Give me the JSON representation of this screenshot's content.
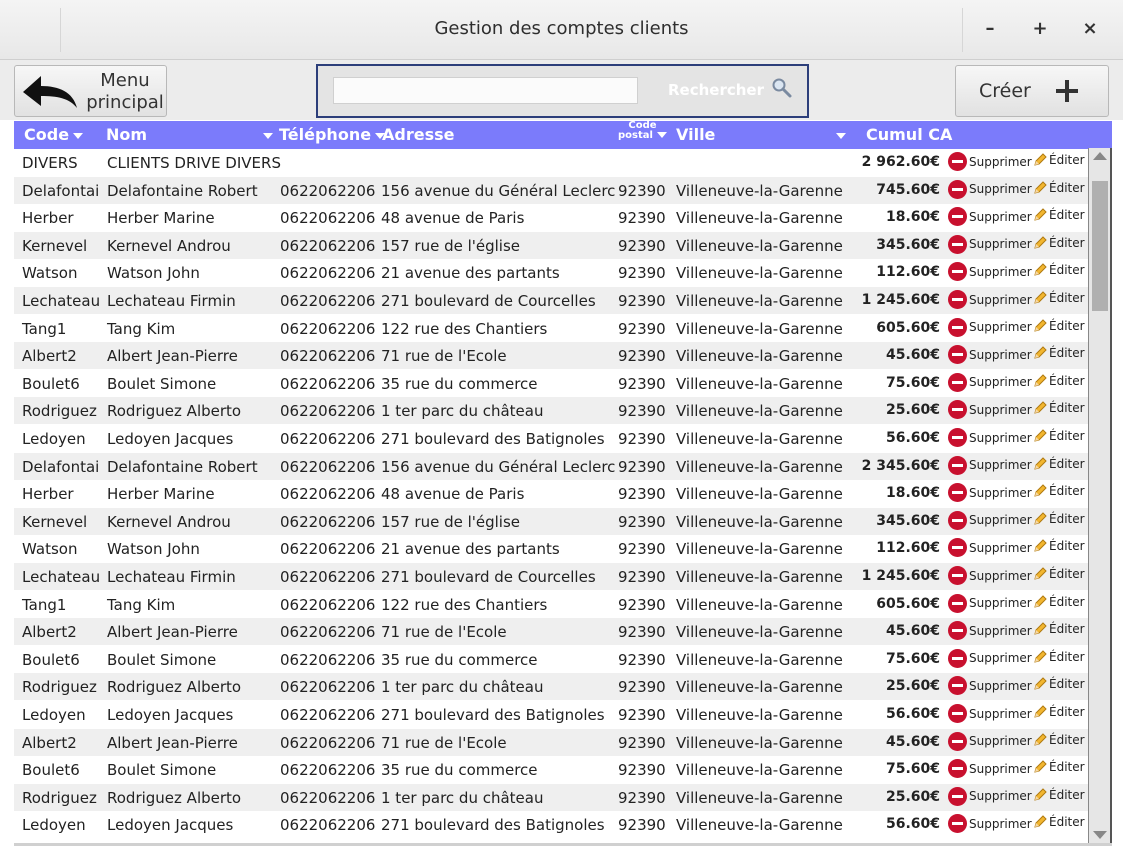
{
  "window": {
    "title": "Gestion des comptes clients",
    "minimize_label": "–",
    "maximize_label": "+",
    "close_label": "×"
  },
  "toolbar": {
    "menu_label_line1": "Menu",
    "menu_label_line2": "principal",
    "search_placeholder": "",
    "search_label": "Rechercher",
    "create_label": "Créer"
  },
  "columns": {
    "code": "Code",
    "nom": "Nom",
    "telephone": "Téléphone",
    "adresse": "Adresse",
    "cp_line1": "Code",
    "cp_line2": "postal",
    "ville": "Ville",
    "ca": "Cumul CA"
  },
  "actions": {
    "delete_label": "Supprimer",
    "edit_label": "Éditer"
  },
  "rows": [
    {
      "code": "DIVERS",
      "nom": "CLIENTS DRIVE DIVERS",
      "tel": "",
      "adr": "",
      "cp": "",
      "ville": "",
      "ca": "2 962.60€"
    },
    {
      "code": "Delafontai",
      "nom": "Delafontaine Robert",
      "tel": "0622062206",
      "adr": "156 avenue du Général Leclerc",
      "cp": "92390",
      "ville": "Villeneuve-la-Garenne",
      "ca": "745.60€"
    },
    {
      "code": "Herber",
      "nom": "Herber Marine",
      "tel": "0622062206",
      "adr": "48 avenue de Paris",
      "cp": "92390",
      "ville": "Villeneuve-la-Garenne",
      "ca": "18.60€"
    },
    {
      "code": "Kernevel",
      "nom": "Kernevel Androu",
      "tel": "0622062206",
      "adr": "157 rue de l'église",
      "cp": "92390",
      "ville": "Villeneuve-la-Garenne",
      "ca": "345.60€"
    },
    {
      "code": "Watson",
      "nom": "Watson John",
      "tel": "0622062206",
      "adr": "21 avenue des partants",
      "cp": "92390",
      "ville": "Villeneuve-la-Garenne",
      "ca": "112.60€"
    },
    {
      "code": "Lechateau",
      "nom": "Lechateau Firmin",
      "tel": "0622062206",
      "adr": "271 boulevard de Courcelles",
      "cp": "92390",
      "ville": "Villeneuve-la-Garenne",
      "ca": "1 245.60€"
    },
    {
      "code": "Tang1",
      "nom": "Tang Kim",
      "tel": "0622062206",
      "adr": "122 rue des Chantiers",
      "cp": "92390",
      "ville": "Villeneuve-la-Garenne",
      "ca": "605.60€"
    },
    {
      "code": "Albert2",
      "nom": "Albert Jean-Pierre",
      "tel": "0622062206",
      "adr": "71 rue de l'Ecole",
      "cp": "92390",
      "ville": "Villeneuve-la-Garenne",
      "ca": "45.60€"
    },
    {
      "code": "Boulet6",
      "nom": "Boulet Simone",
      "tel": "0622062206",
      "adr": "35 rue du commerce",
      "cp": "92390",
      "ville": "Villeneuve-la-Garenne",
      "ca": "75.60€"
    },
    {
      "code": "Rodriguez",
      "nom": "Rodriguez Alberto",
      "tel": "0622062206",
      "adr": "1 ter parc du château",
      "cp": "92390",
      "ville": "Villeneuve-la-Garenne",
      "ca": "25.60€"
    },
    {
      "code": "Ledoyen",
      "nom": "Ledoyen Jacques",
      "tel": "0622062206",
      "adr": "271 boulevard des Batignoles",
      "cp": "92390",
      "ville": "Villeneuve-la-Garenne",
      "ca": "56.60€"
    },
    {
      "code": "Delafontai",
      "nom": "Delafontaine Robert",
      "tel": "0622062206",
      "adr": "156 avenue du Général Leclerc",
      "cp": "92390",
      "ville": "Villeneuve-la-Garenne",
      "ca": "2 345.60€"
    },
    {
      "code": "Herber",
      "nom": "Herber Marine",
      "tel": "0622062206",
      "adr": "48 avenue de Paris",
      "cp": "92390",
      "ville": "Villeneuve-la-Garenne",
      "ca": "18.60€"
    },
    {
      "code": "Kernevel",
      "nom": "Kernevel Androu",
      "tel": "0622062206",
      "adr": "157 rue de l'église",
      "cp": "92390",
      "ville": "Villeneuve-la-Garenne",
      "ca": "345.60€"
    },
    {
      "code": "Watson",
      "nom": "Watson John",
      "tel": "0622062206",
      "adr": "21 avenue des partants",
      "cp": "92390",
      "ville": "Villeneuve-la-Garenne",
      "ca": "112.60€"
    },
    {
      "code": "Lechateau",
      "nom": "Lechateau Firmin",
      "tel": "0622062206",
      "adr": "271 boulevard de Courcelles",
      "cp": "92390",
      "ville": "Villeneuve-la-Garenne",
      "ca": "1 245.60€"
    },
    {
      "code": "Tang1",
      "nom": "Tang Kim",
      "tel": "0622062206",
      "adr": "122 rue des Chantiers",
      "cp": "92390",
      "ville": "Villeneuve-la-Garenne",
      "ca": "605.60€"
    },
    {
      "code": "Albert2",
      "nom": "Albert Jean-Pierre",
      "tel": "0622062206",
      "adr": "71 rue de l'Ecole",
      "cp": "92390",
      "ville": "Villeneuve-la-Garenne",
      "ca": "45.60€"
    },
    {
      "code": "Boulet6",
      "nom": "Boulet Simone",
      "tel": "0622062206",
      "adr": "35 rue du commerce",
      "cp": "92390",
      "ville": "Villeneuve-la-Garenne",
      "ca": "75.60€"
    },
    {
      "code": "Rodriguez",
      "nom": "Rodriguez Alberto",
      "tel": "0622062206",
      "adr": "1 ter parc du château",
      "cp": "92390",
      "ville": "Villeneuve-la-Garenne",
      "ca": "25.60€"
    },
    {
      "code": "Ledoyen",
      "nom": "Ledoyen Jacques",
      "tel": "0622062206",
      "adr": "271 boulevard des Batignoles",
      "cp": "92390",
      "ville": "Villeneuve-la-Garenne",
      "ca": "56.60€"
    },
    {
      "code": "Albert2",
      "nom": "Albert Jean-Pierre",
      "tel": "0622062206",
      "adr": "71 rue de l'Ecole",
      "cp": "92390",
      "ville": "Villeneuve-la-Garenne",
      "ca": "45.60€"
    },
    {
      "code": "Boulet6",
      "nom": "Boulet Simone",
      "tel": "0622062206",
      "adr": "35 rue du commerce",
      "cp": "92390",
      "ville": "Villeneuve-la-Garenne",
      "ca": "75.60€"
    },
    {
      "code": "Rodriguez",
      "nom": "Rodriguez Alberto",
      "tel": "0622062206",
      "adr": "1 ter parc du château",
      "cp": "92390",
      "ville": "Villeneuve-la-Garenne",
      "ca": "25.60€"
    },
    {
      "code": "Ledoyen",
      "nom": "Ledoyen Jacques",
      "tel": "0622062206",
      "adr": "271 boulevard des Batignoles",
      "cp": "92390",
      "ville": "Villeneuve-la-Garenne",
      "ca": "56.60€"
    }
  ],
  "colors": {
    "header_bg": "#7b7bfb",
    "search_border": "#2c3e7a",
    "delete_icon": "#c8102e",
    "row_alt": "#efefef"
  },
  "icons": {
    "back": "back-arrow-icon",
    "search": "magnifier-icon",
    "create": "plus-icon",
    "delete": "no-entry-icon",
    "edit": "pencil-icon"
  }
}
